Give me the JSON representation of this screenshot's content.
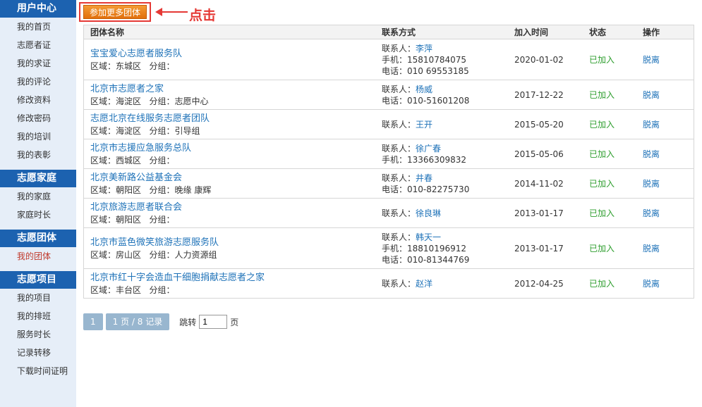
{
  "sidebar": {
    "sections": [
      {
        "title": "用户中心",
        "items": [
          "我的首页",
          "志愿者证",
          "我的求证",
          "我的评论",
          "修改资料",
          "修改密码",
          "我的培训",
          "我的表彰"
        ]
      },
      {
        "title": "志愿家庭",
        "items": [
          "我的家庭",
          "家庭时长"
        ]
      },
      {
        "title": "志愿团体",
        "items": [
          "我的团体"
        ]
      },
      {
        "title": "志愿项目",
        "items": [
          "我的项目",
          "我的排班",
          "服务时长",
          "记录转移",
          "下载时间证明"
        ]
      }
    ],
    "active_item": "我的团体",
    "active_color": "#c0392b"
  },
  "toolbar": {
    "join_button": "参加更多团体",
    "annotation": "点击",
    "annotation_color": "#e53935"
  },
  "table": {
    "headers": [
      "团体名称",
      "联系方式",
      "加入时间",
      "状态",
      "操作"
    ],
    "labels": {
      "region": "区域：",
      "group": "分组：",
      "contact": "联系人：",
      "mobile": "手机：",
      "phone": "电话："
    },
    "rows": [
      {
        "name": "宝宝爱心志愿者服务队",
        "region": "东城区",
        "group": "",
        "contact": "李萍",
        "mobile": "15810784075",
        "phone": "010 69553185",
        "date": "2020-01-02",
        "status": "已加入",
        "op": "脱离"
      },
      {
        "name": "北京市志愿者之家",
        "region": "海淀区",
        "group": "志愿中心",
        "contact": "杨威",
        "mobile": "",
        "phone": "010-51601208",
        "date": "2017-12-22",
        "status": "已加入",
        "op": "脱离"
      },
      {
        "name": "志愿北京在线服务志愿者团队",
        "region": "海淀区",
        "group": "引导组",
        "contact": "王开",
        "mobile": "",
        "phone": "",
        "date": "2015-05-20",
        "status": "已加入",
        "op": "脱离"
      },
      {
        "name": "北京市志援应急服务总队",
        "region": "西城区",
        "group": "",
        "contact": "徐广春",
        "mobile": "13366309832",
        "phone": "",
        "date": "2015-05-06",
        "status": "已加入",
        "op": "脱离"
      },
      {
        "name": "北京美新路公益基金会",
        "region": "朝阳区",
        "group": "晚缘 康辉",
        "contact": "井春",
        "mobile": "",
        "phone": "010-82275730",
        "date": "2014-11-02",
        "status": "已加入",
        "op": "脱离"
      },
      {
        "name": "北京旅游志愿者联合会",
        "region": "朝阳区",
        "group": "",
        "contact": "徐良琳",
        "mobile": "",
        "phone": "",
        "date": "2013-01-17",
        "status": "已加入",
        "op": "脱离"
      },
      {
        "name": "北京市蓝色微笑旅游志愿服务队",
        "region": "房山区",
        "group": "人力资源组",
        "contact": "韩天一",
        "mobile": "18810196912",
        "phone": "010-81344769",
        "date": "2013-01-17",
        "status": "已加入",
        "op": "脱离"
      },
      {
        "name": "北京市红十字会造血干细胞捐献志愿者之家",
        "region": "丰台区",
        "group": "",
        "contact": "赵洋",
        "mobile": "",
        "phone": "",
        "date": "2012-04-25",
        "status": "已加入",
        "op": "脱离"
      }
    ]
  },
  "pager": {
    "current": "1",
    "summary": "1 页 / 8 记录",
    "jump_label": "跳转",
    "jump_value": "1",
    "page_unit": "页"
  }
}
